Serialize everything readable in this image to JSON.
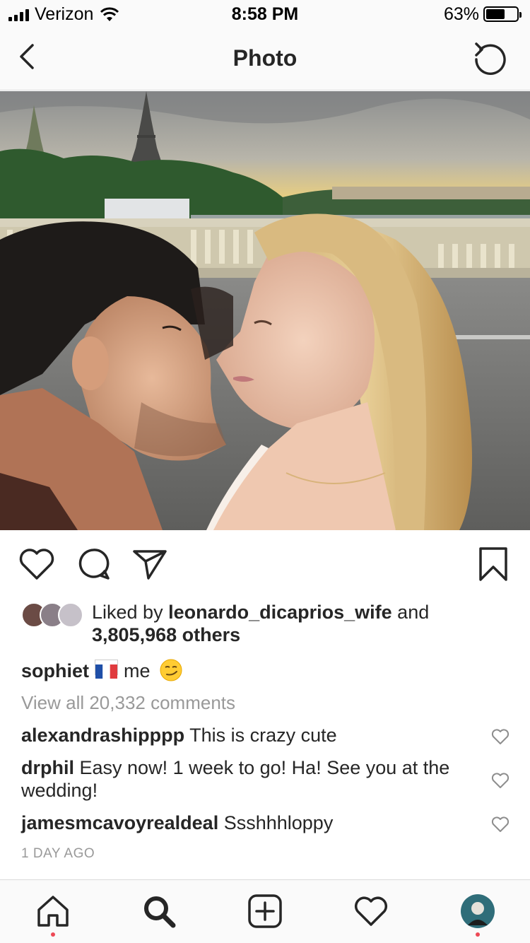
{
  "status_bar": {
    "carrier": "Verizon",
    "time": "8:58 PM",
    "battery_percent": "63%",
    "battery_level": 0.63
  },
  "nav": {
    "title": "Photo",
    "back_icon": "chevron-left-icon",
    "refresh_icon": "refresh-icon"
  },
  "post": {
    "photo_alt": "Couple kissing on a bridge in Paris with Eiffel Tower behind",
    "likes": {
      "prefix": "Liked by ",
      "first_liker": "leonardo_dicaprios_wife",
      "and": " and",
      "others": "3,805,968 others"
    },
    "caption": {
      "username": "sophiet",
      "text": "me"
    },
    "view_all_comments": "View all 20,332 comments",
    "comments": [
      {
        "username": "alexandrashipppp",
        "text": "This is crazy cute"
      },
      {
        "username": "drphil",
        "text": "Easy now! 1 week to go! Ha! See you at the wedding!"
      },
      {
        "username": "jamesmcavoyrealdeal",
        "text": "Ssshhhloppy"
      }
    ],
    "time_ago": "1 DAY AGO"
  },
  "tabs": [
    {
      "name": "home",
      "icon": "home-icon",
      "active": false,
      "dot": true
    },
    {
      "name": "search",
      "icon": "search-icon",
      "active": true,
      "dot": false
    },
    {
      "name": "new-post",
      "icon": "plus-square-icon",
      "active": false,
      "dot": false
    },
    {
      "name": "activity",
      "icon": "heart-icon",
      "active": false,
      "dot": false
    },
    {
      "name": "profile",
      "icon": "avatar-icon",
      "active": false,
      "dot": true
    }
  ],
  "colors": {
    "text": "#262626",
    "muted": "#999999",
    "notification_dot": "#ed4956",
    "bar_background": "#fafafa",
    "divider": "#dbdbdb"
  }
}
